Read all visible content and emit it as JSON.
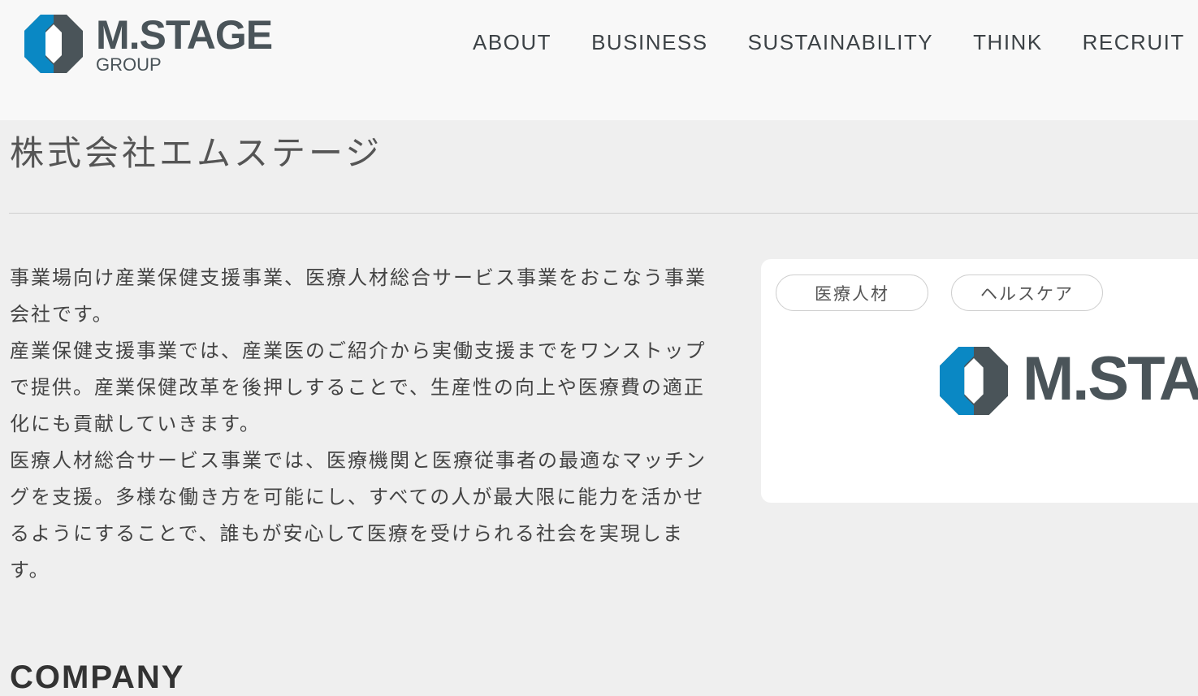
{
  "header": {
    "logo": {
      "wordmark": "M.STAGE",
      "sub": "GROUP",
      "colors": {
        "blue": "#0a88c4",
        "gray": "#4a5459"
      }
    },
    "nav": [
      {
        "label": "ABOUT"
      },
      {
        "label": "BUSINESS"
      },
      {
        "label": "SUSTAINABILITY"
      },
      {
        "label": "THINK"
      },
      {
        "label": "RECRUIT"
      }
    ]
  },
  "page": {
    "title": "株式会社エムステージ",
    "description": [
      "事業場向け産業保健支援事業、医療人材総合サービス事業をおこなう事業会社です。",
      "産業保健支援事業では、産業医のご紹介から実働支援までをワンストップで提供。産業保健改革を後押しすることで、生産性の向上や医療費の適正化にも貢献していきます。",
      "医療人材総合サービス事業では、医療機関と医療従事者の最適なマッチングを支援。多様な働き方を可能にし、すべての人が最大限に能力を活かせるようにすることで、誰もが安心して医療を受けられる社会を実現します。"
    ]
  },
  "card": {
    "tags": [
      "医療人材",
      "ヘルスケア"
    ],
    "logo_wordmark": "M.STAGE"
  },
  "section": {
    "heading": "COMPANY"
  }
}
